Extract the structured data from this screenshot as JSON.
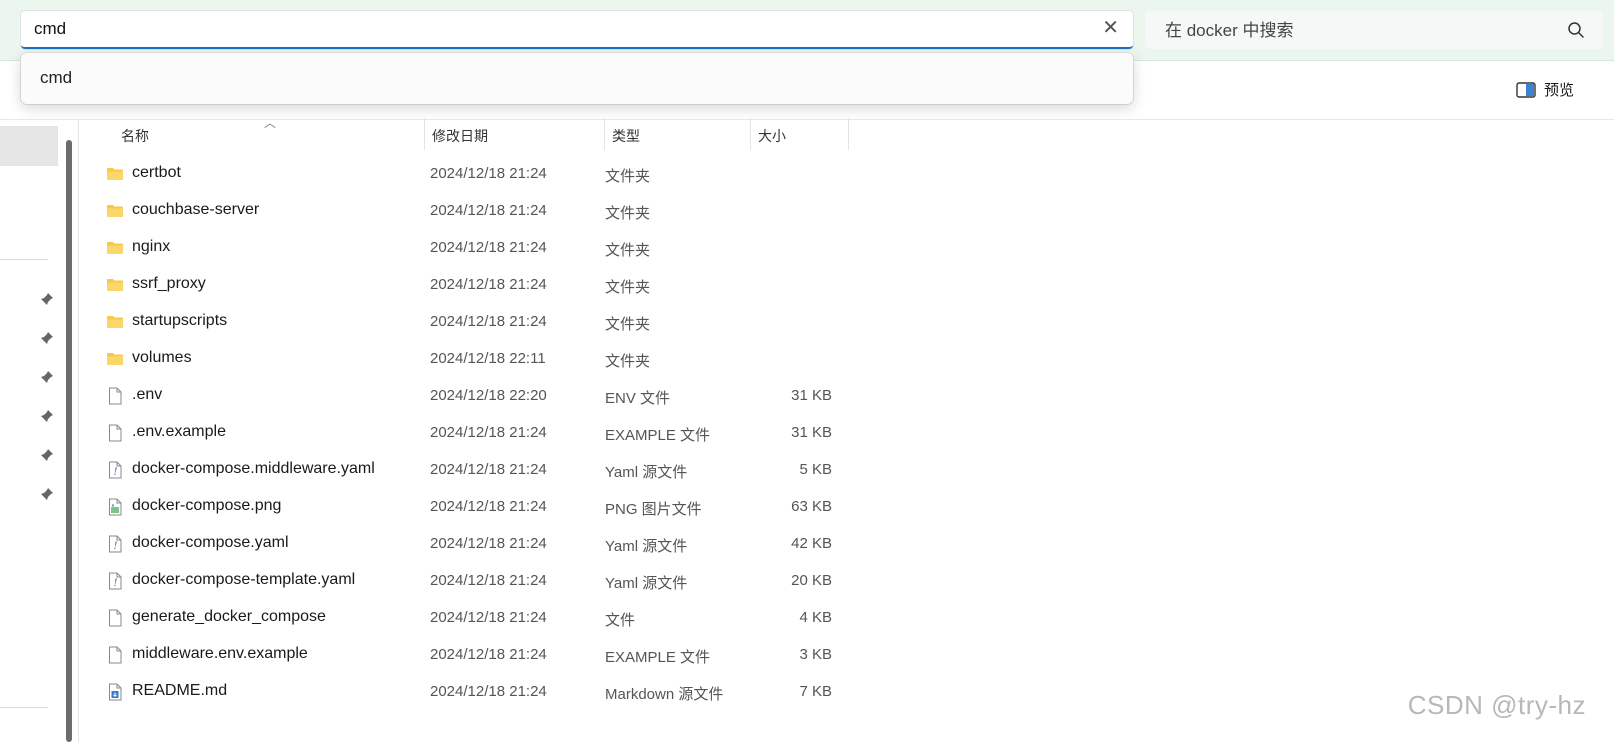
{
  "address_bar": {
    "value": "cmd",
    "clear_icon": "close-icon"
  },
  "search": {
    "placeholder": "在 docker 中搜索",
    "icon": "search-icon"
  },
  "autocomplete": {
    "items": [
      "cmd"
    ]
  },
  "toolbar": {
    "preview_label": "预览",
    "preview_icon": "preview-pane-icon"
  },
  "columns": {
    "name": "名称",
    "date": "修改日期",
    "type": "类型",
    "size": "大小"
  },
  "files": [
    {
      "icon": "folder-icon",
      "name": "certbot",
      "date": "2024/12/18 21:24",
      "type": "文件夹",
      "size": ""
    },
    {
      "icon": "folder-icon",
      "name": "couchbase-server",
      "date": "2024/12/18 21:24",
      "type": "文件夹",
      "size": ""
    },
    {
      "icon": "folder-icon",
      "name": "nginx",
      "date": "2024/12/18 21:24",
      "type": "文件夹",
      "size": ""
    },
    {
      "icon": "folder-icon",
      "name": "ssrf_proxy",
      "date": "2024/12/18 21:24",
      "type": "文件夹",
      "size": ""
    },
    {
      "icon": "folder-icon",
      "name": "startupscripts",
      "date": "2024/12/18 21:24",
      "type": "文件夹",
      "size": ""
    },
    {
      "icon": "folder-icon",
      "name": "volumes",
      "date": "2024/12/18 22:11",
      "type": "文件夹",
      "size": ""
    },
    {
      "icon": "file-icon",
      "name": ".env",
      "date": "2024/12/18 22:20",
      "type": "ENV 文件",
      "size": "31 KB"
    },
    {
      "icon": "file-icon",
      "name": ".env.example",
      "date": "2024/12/18 21:24",
      "type": "EXAMPLE 文件",
      "size": "31 KB"
    },
    {
      "icon": "yaml-file-icon",
      "name": "docker-compose.middleware.yaml",
      "date": "2024/12/18 21:24",
      "type": "Yaml 源文件",
      "size": "5 KB"
    },
    {
      "icon": "image-file-icon",
      "name": "docker-compose.png",
      "date": "2024/12/18 21:24",
      "type": "PNG 图片文件",
      "size": "63 KB"
    },
    {
      "icon": "yaml-file-icon",
      "name": "docker-compose.yaml",
      "date": "2024/12/18 21:24",
      "type": "Yaml 源文件",
      "size": "42 KB"
    },
    {
      "icon": "yaml-file-icon",
      "name": "docker-compose-template.yaml",
      "date": "2024/12/18 21:24",
      "type": "Yaml 源文件",
      "size": "20 KB"
    },
    {
      "icon": "file-icon",
      "name": "generate_docker_compose",
      "date": "2024/12/18 21:24",
      "type": "文件",
      "size": "4 KB"
    },
    {
      "icon": "file-icon",
      "name": "middleware.env.example",
      "date": "2024/12/18 21:24",
      "type": "EXAMPLE 文件",
      "size": "3 KB"
    },
    {
      "icon": "markdown-file-icon",
      "name": "README.md",
      "date": "2024/12/18 21:24",
      "type": "Markdown 源文件",
      "size": "7 KB"
    }
  ],
  "watermark": "CSDN @try-hz",
  "colors": {
    "accent": "#1a6fc4",
    "topbar_bg": "#eaf6ee",
    "folder": "#f7c948"
  }
}
